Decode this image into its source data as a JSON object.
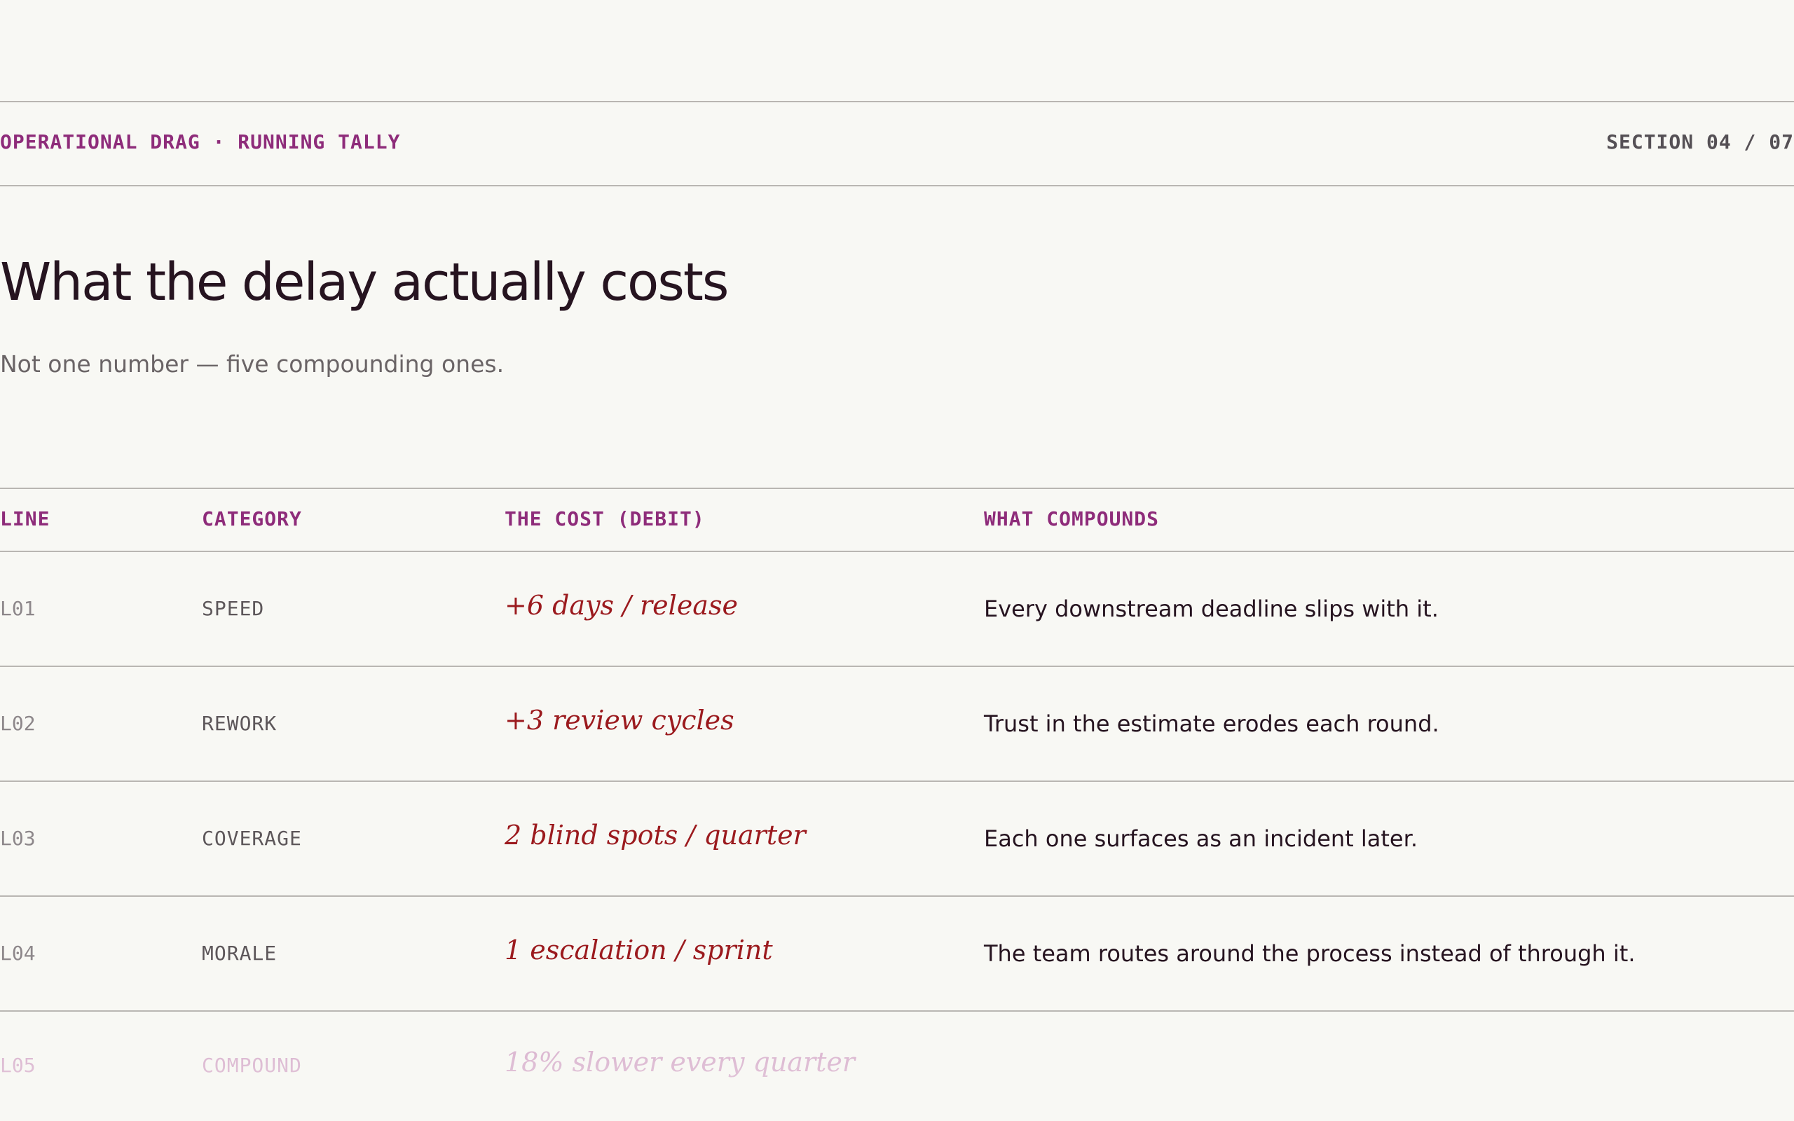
{
  "header": {
    "eyebrow": "OPERATIONAL DRAG · RUNNING TALLY",
    "section": "SECTION 04 / 07"
  },
  "title": "What the delay actually costs",
  "subtitle": "Not one number — five compounding ones.",
  "table": {
    "columns": [
      "LINE",
      "CATEGORY",
      "THE COST (DEBIT)",
      "WHAT COMPOUNDS"
    ],
    "rows": [
      {
        "line": "L01",
        "category": "SPEED",
        "cost": "+6 days / release",
        "compounds": "Every downstream deadline slips with it."
      },
      {
        "line": "L02",
        "category": "REWORK",
        "cost": "+3 review cycles",
        "compounds": "Trust in the estimate erodes each round."
      },
      {
        "line": "L03",
        "category": "COVERAGE",
        "cost": "2 blind spots / quarter",
        "compounds": "Each one surfaces as an incident later."
      },
      {
        "line": "L04",
        "category": "MORALE",
        "cost": "1 escalation / sprint",
        "compounds": "The team routes around the process instead of through it."
      },
      {
        "line": "L05",
        "category": "COMPOUND",
        "cost": "18% slower every quarter",
        "compounds": ""
      }
    ]
  },
  "colors": {
    "accent": "#8e2c7a",
    "debit": "#9b1a1e",
    "background": "#f8f8f4"
  }
}
